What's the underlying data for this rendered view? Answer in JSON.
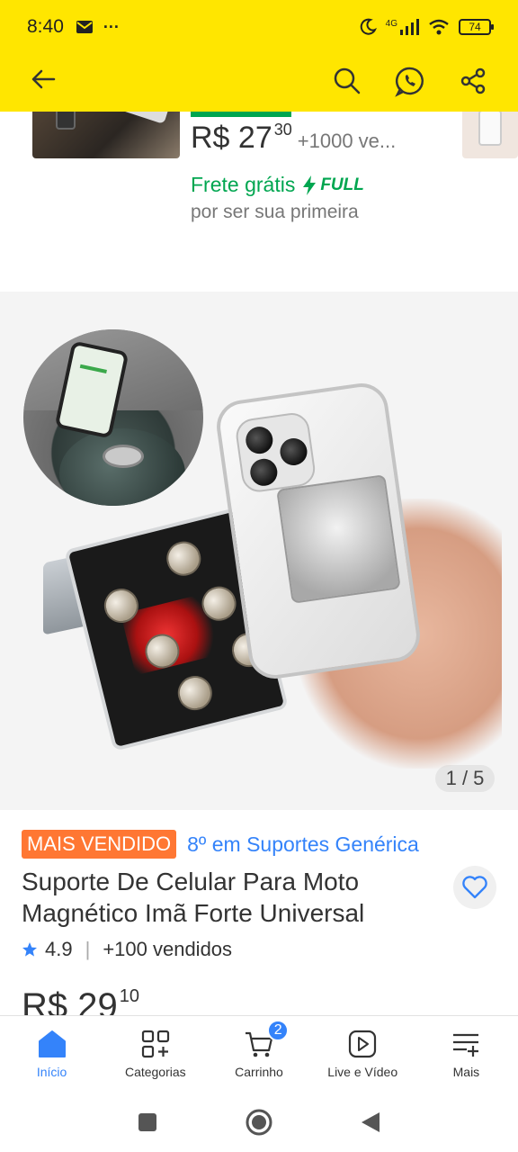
{
  "status_bar": {
    "time": "8:40",
    "more": "···",
    "network": "4G",
    "battery": "74"
  },
  "header": {
    "icons": [
      "arrow-left-icon",
      "search-icon",
      "whatsapp-icon",
      "share-icon"
    ],
    "background_color": "#ffe600"
  },
  "previous_item": {
    "price_main": "R$ 27",
    "price_cents": "30",
    "sold": "+1000 ve...",
    "shipping": "Frete grátis",
    "full_label": "FULL",
    "shipping_note": "por ser sua primeira"
  },
  "gallery": {
    "counter": "1 / 5"
  },
  "product": {
    "badge": "MAIS VENDIDO",
    "rank": "8º em Suportes Genérica",
    "title": "Suporte De Celular Para Moto Magnético Imã Forte Universal",
    "rating": "4.9",
    "sold": "+100 vendidos",
    "price_main": "R$ 29",
    "price_cents": "10"
  },
  "tabbar": {
    "items": [
      {
        "label": "Início",
        "icon": "home-icon",
        "active": true
      },
      {
        "label": "Categorias",
        "icon": "categories-icon",
        "active": false
      },
      {
        "label": "Carrinho",
        "icon": "cart-icon",
        "active": false
      },
      {
        "label": "Live e Vídeo",
        "icon": "play-icon",
        "active": false
      },
      {
        "label": "Mais",
        "icon": "menu-plus-icon",
        "active": false
      }
    ],
    "cart_count": "2"
  },
  "colors": {
    "accent": "#3483fa",
    "green": "#00a650",
    "badge": "#ff7733"
  }
}
